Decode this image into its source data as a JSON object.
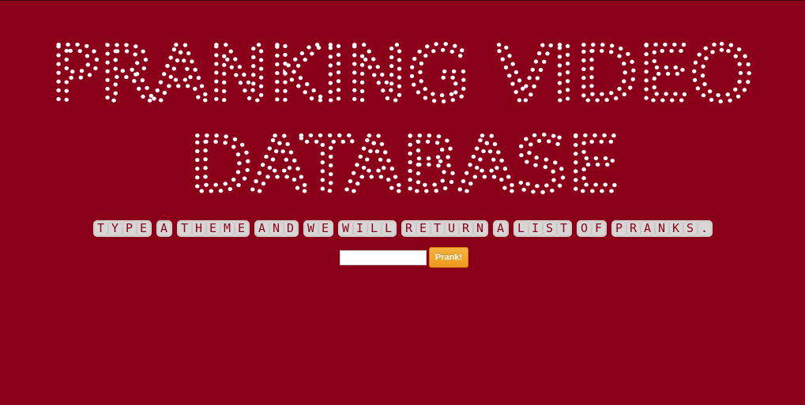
{
  "header": {
    "title_line1": "PRANKING VIDEO",
    "title_line2": "DATABASE"
  },
  "tagline": {
    "text": "Type a theme and we will return a list of pranks.",
    "words": [
      "TYPE",
      "A",
      "THEME",
      "AND",
      "WE",
      "WILL",
      "RETURN",
      "A",
      "LIST",
      "OF",
      "PRANKS."
    ]
  },
  "search": {
    "value": "",
    "placeholder": "",
    "button_label": "Prank!"
  },
  "colors": {
    "background": "#8a0019",
    "title_dots": "#ffffff",
    "tile_bg": "#d9d7d5",
    "button": "#f0a02a"
  }
}
